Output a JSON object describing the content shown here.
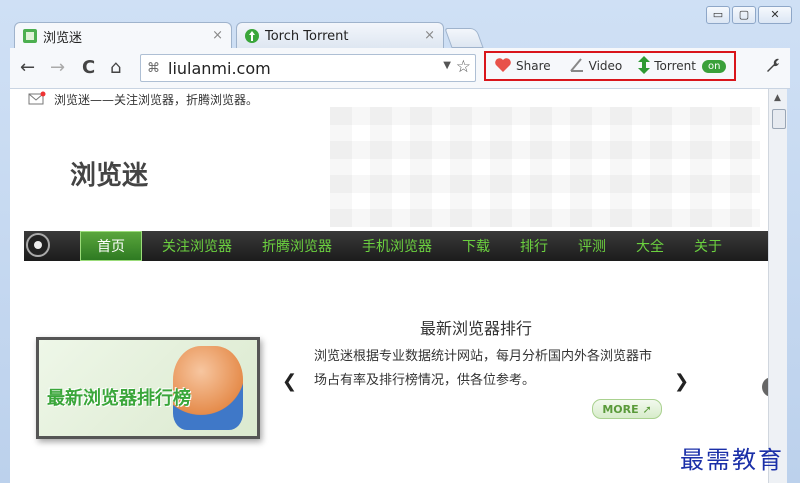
{
  "window": {
    "minimize_glyph": "▭",
    "maximize_glyph": "▢",
    "close_glyph": "✕"
  },
  "tabs": [
    {
      "label": "浏览迷",
      "favicon": "green-page-icon",
      "close": "×",
      "active": true
    },
    {
      "label": "Torch Torrent",
      "favicon": "green-torrent-icon",
      "close": "×",
      "active": false
    }
  ],
  "toolbar": {
    "back": "←",
    "forward": "→",
    "reload": "C",
    "home": "⌂",
    "url": "liulanmi.com",
    "dropdown": "▼",
    "star": "☆",
    "wrench": "🔧"
  },
  "extensions": {
    "share": {
      "label": "Share",
      "icon": "heart-icon",
      "color": "#e8524a"
    },
    "video": {
      "label": "Video",
      "icon": "video-icon"
    },
    "torrent": {
      "label": "Torrent",
      "icon": "updown-arrow-icon",
      "color": "#2e9a33"
    },
    "on_badge": "on",
    "highlight_color": "#d9151b"
  },
  "page": {
    "notice": "浏览迷——关注浏览器，折腾浏览器。",
    "logo": "浏览迷",
    "nav": [
      "首页",
      "关注浏览器",
      "折腾浏览器",
      "手机浏览器",
      "下载",
      "排行",
      "评测",
      "大全",
      "关于"
    ],
    "banner_caption": "最新浏览器排行榜",
    "section_title": "最新浏览器排行",
    "section_body": "浏览迷根据专业数据统计网站，每月分析国内外各浏览器市场占有率及排行榜情况，供各位参考。",
    "prev": "❮",
    "next": "❯",
    "more": "MORE ➚",
    "accent": "#6bd13f"
  },
  "watermark": "最需教育"
}
